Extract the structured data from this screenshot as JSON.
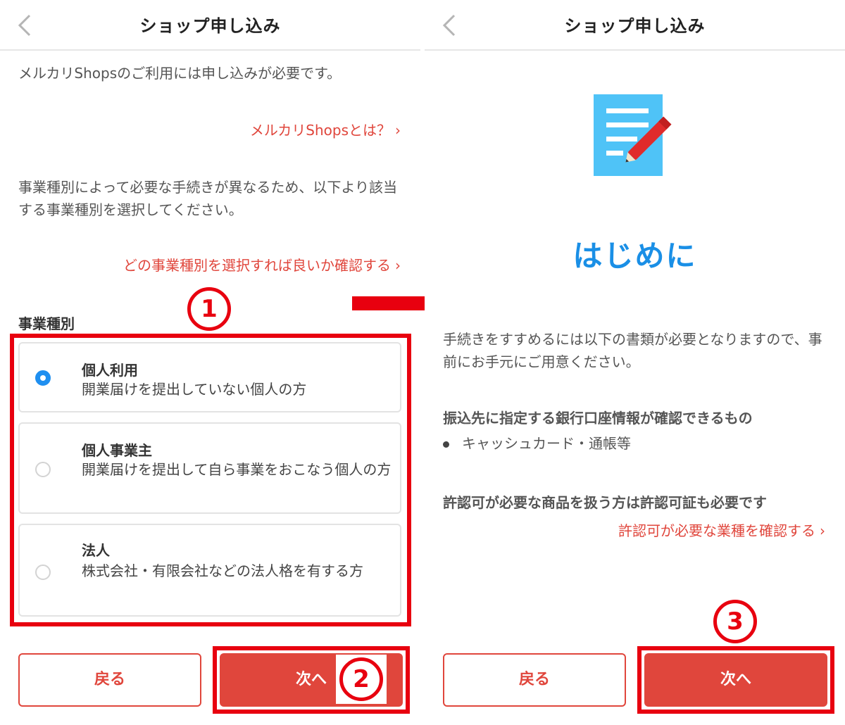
{
  "colors": {
    "accent": "#e0463c",
    "frame": "#e8000f",
    "radio_on": "#1f8ff0",
    "doc_icon": "#4fc3f7",
    "heading_blue": "#1a8fe6"
  },
  "left": {
    "header_title": "ショップ申し込み",
    "intro": "メルカリShopsのご利用には申し込みが必要です。",
    "about_link": "メルカリShopsとは？",
    "description": "事業種別によって必要な手続きが異なるため、以下より該当する事業種別を選択してください。",
    "which_link": "どの事業種別を選択すれば良いか確認する",
    "section_label": "事業種別",
    "options": [
      {
        "title": "個人利用",
        "desc": "開業届けを提出していない個人の方",
        "selected": true
      },
      {
        "title": "個人事業主",
        "desc": "開業届けを提出して自ら事業をおこなう個人の方",
        "selected": false
      },
      {
        "title": "法人",
        "desc": "株式会社・有限会社などの法人格を有する方",
        "selected": false
      }
    ],
    "back_label": "戻る",
    "next_label": "次へ",
    "marker_1": "1",
    "marker_2": "2"
  },
  "right": {
    "header_title": "ショップ申し込み",
    "heading": "はじめに",
    "intro": "手続きをすすめるには以下の書類が必要となりますので、事前にお手元にご用意ください。",
    "bank_title": "振込先に指定する銀行口座情報が確認できるもの",
    "bank_item": "キャッシュカード・通帳等",
    "permit_title": "許認可が必要な商品を扱う方は許認可証も必要です",
    "permit_link": "許認可が必要な業種を確認する",
    "back_label": "戻る",
    "next_label": "次へ",
    "marker_3": "3"
  },
  "icons": {
    "back": "chevron-left-icon",
    "chevron": "chevron-right-icon",
    "doc": "document-pencil-icon",
    "arrow": "arrow-right-icon"
  }
}
